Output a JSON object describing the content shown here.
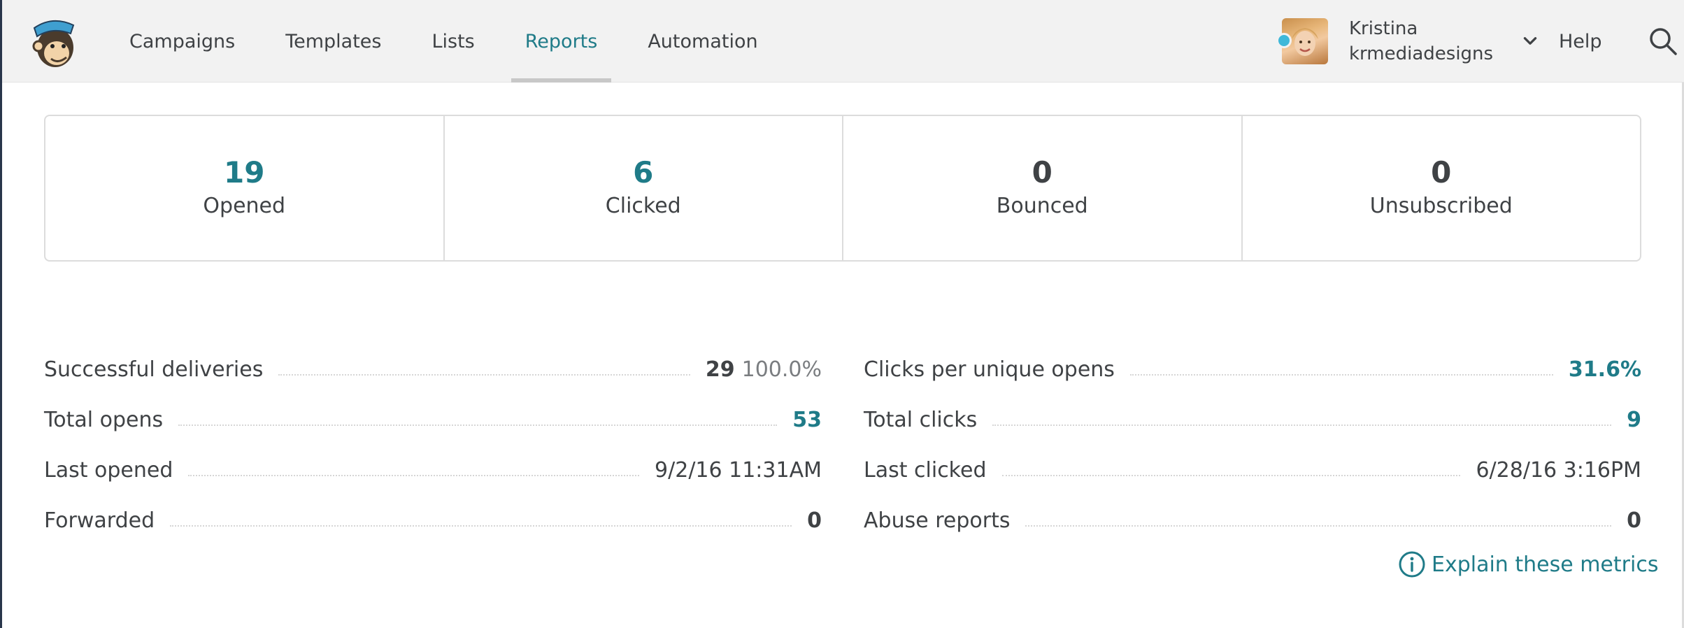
{
  "header": {
    "nav": [
      {
        "label": "Campaigns"
      },
      {
        "label": "Templates"
      },
      {
        "label": "Lists"
      },
      {
        "label": "Reports",
        "active": true
      },
      {
        "label": "Automation"
      }
    ],
    "account": {
      "name": "Kristina",
      "org": "krmediadesigns"
    },
    "help_label": "Help",
    "icons": {
      "logo": "freddie-logo-icon",
      "dropdown": "chevron-down-icon",
      "search": "search-icon"
    }
  },
  "stats": [
    {
      "value": "19",
      "label": "Opened",
      "highlight": true
    },
    {
      "value": "6",
      "label": "Clicked",
      "highlight": true
    },
    {
      "value": "0",
      "label": "Bounced",
      "highlight": false
    },
    {
      "value": "0",
      "label": "Unsubscribed",
      "highlight": false
    }
  ],
  "metrics_left": [
    {
      "label": "Successful deliveries",
      "value": "29",
      "extra": "100.0%"
    },
    {
      "label": "Total opens",
      "value": "53"
    },
    {
      "label": "Last opened",
      "value": "9/2/16 11:31AM"
    },
    {
      "label": "Forwarded",
      "value": "0"
    }
  ],
  "metrics_right": [
    {
      "label": "Clicks per unique opens",
      "value": "31.6%"
    },
    {
      "label": "Total clicks",
      "value": "9"
    },
    {
      "label": "Last clicked",
      "value": "6/28/16 3:16PM"
    },
    {
      "label": "Abuse reports",
      "value": "0"
    }
  ],
  "explain_link": "Explain these metrics",
  "colors": {
    "accent": "#1f7b88",
    "text": "#3f4245",
    "status_dot": "#3fb8d9"
  }
}
